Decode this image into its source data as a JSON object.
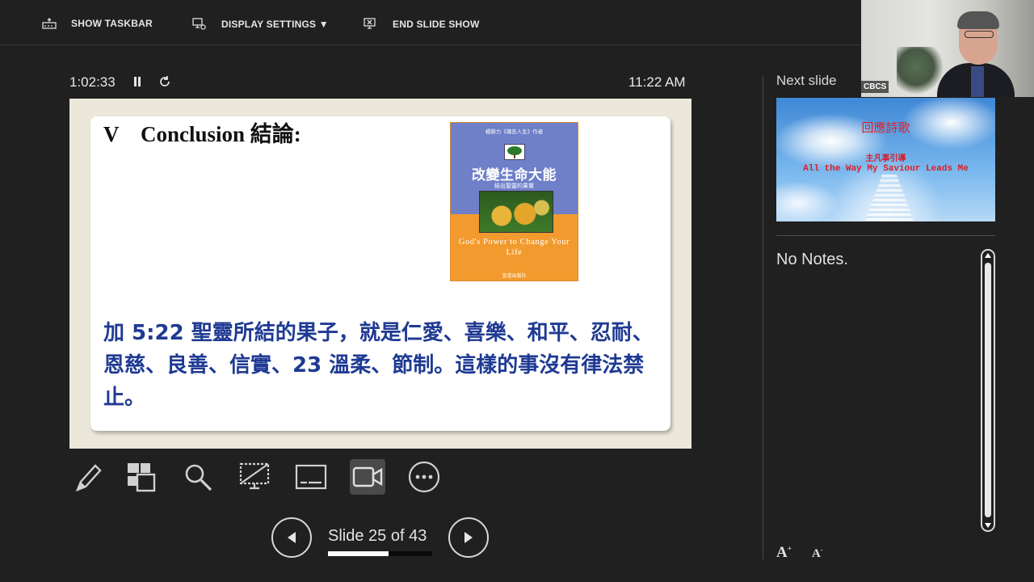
{
  "toolbar": {
    "show_taskbar": "SHOW TASKBAR",
    "display_settings": "DISPLAY SETTINGS ▼",
    "end_slide_show": "END SLIDE SHOW"
  },
  "timer": {
    "elapsed": "1:02:33",
    "clock": "11:22 AM"
  },
  "slide": {
    "title": "V    Conclusion 結論:",
    "body": "加 5:22 聖靈所結的果子，就是仁愛、喜樂、和平、忍耐、恩慈、良善、信實、23 溫柔、節制。這樣的事沒有律法禁止。",
    "book": {
      "author_line": "楊腓力《禱告人生》作者",
      "chinese_title": "改變生命大能",
      "chinese_subtitle": "結出聖靈的果實",
      "english_title": "God's Power to Change Your Life",
      "publisher": "宣道出版社"
    }
  },
  "tools": [
    "pen-icon",
    "see-all-slides-icon",
    "zoom-icon",
    "black-screen-icon",
    "subtitles-icon",
    "camera-icon",
    "more-options-icon"
  ],
  "navigation": {
    "counter": "Slide 25 of 43",
    "current": 25,
    "total": 43
  },
  "next_slide": {
    "label": "Next slide",
    "title": "回應詩歌",
    "subtitle_cn": "主凡事引導",
    "subtitle_en": "All the Way My Saviour Leads Me"
  },
  "notes": {
    "text": "No Notes."
  },
  "webcam": {
    "label": "CBCS"
  }
}
